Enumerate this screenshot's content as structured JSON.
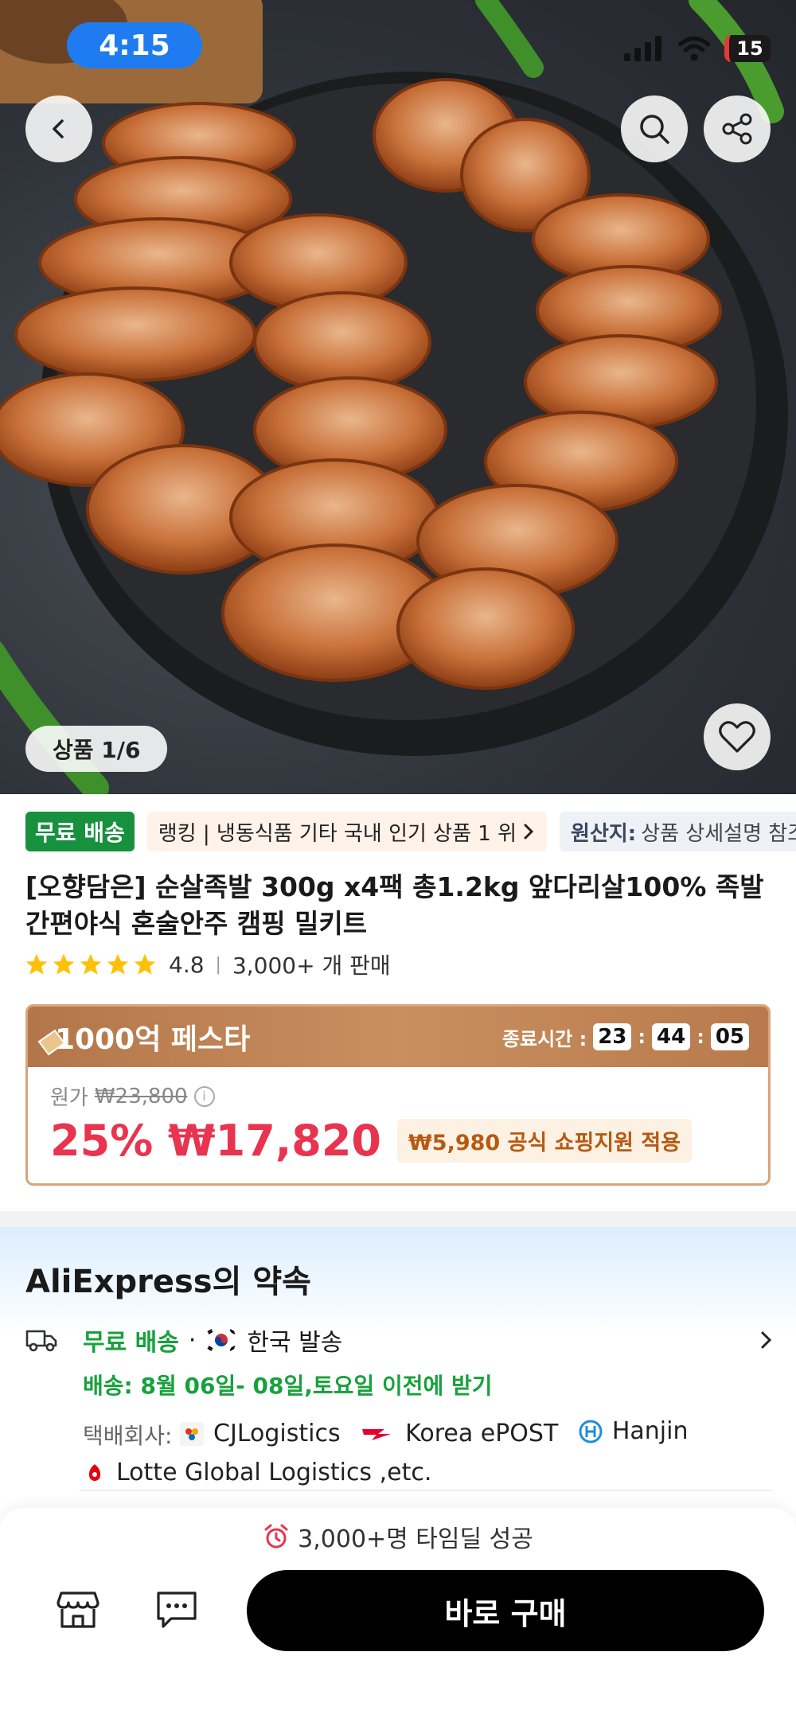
{
  "status_bar": {
    "time": "4:15",
    "battery": "15"
  },
  "gallery": {
    "counter": "상품 1/6"
  },
  "tags": {
    "free_shipping": "무료 배송",
    "ranking": "랭킹 | 냉동식품 기타 국내 인기 상품 1 위",
    "origin_label": "원산지:",
    "origin_value": "상품 상세설명 참조"
  },
  "product": {
    "title": "[오향담은] 순살족발 300g x4팩 총1.2kg 앞다리살100% 족발 간편야식 혼술안주 캠핑 밀키트",
    "rating": "4.8",
    "sold": "3,000+ 개 판매",
    "star_count": 5
  },
  "deal": {
    "title": "1000억 페스타",
    "end_label": "종료시간 :",
    "hours": "23",
    "minutes": "44",
    "seconds": "05",
    "original_label": "원가",
    "original_price": "₩23,800",
    "discount_price": "25% ₩17,820",
    "coupon": "₩5,980 공식 쇼핑지원 적용"
  },
  "promise": {
    "title": "AliExpress의 약속",
    "free_shipping": "무료 배송",
    "dot": "·",
    "ship_from": "한국 발송",
    "delivery": "배송: 8월 06일- 08일,토요일 이전에 받기",
    "carrier_label": "택배회사:",
    "carriers": [
      "CJLogistics",
      "Korea ePOST",
      "Hanjin",
      "Lotte Global Logistics ,etc."
    ]
  },
  "bottom_bar": {
    "success": "3,000+명 타임딜 성공",
    "buy_label": "바로 구매"
  },
  "colors": {
    "accent_green": "#17a13c",
    "price_red": "#e8344f",
    "deal_brown": "#c98f5f"
  }
}
